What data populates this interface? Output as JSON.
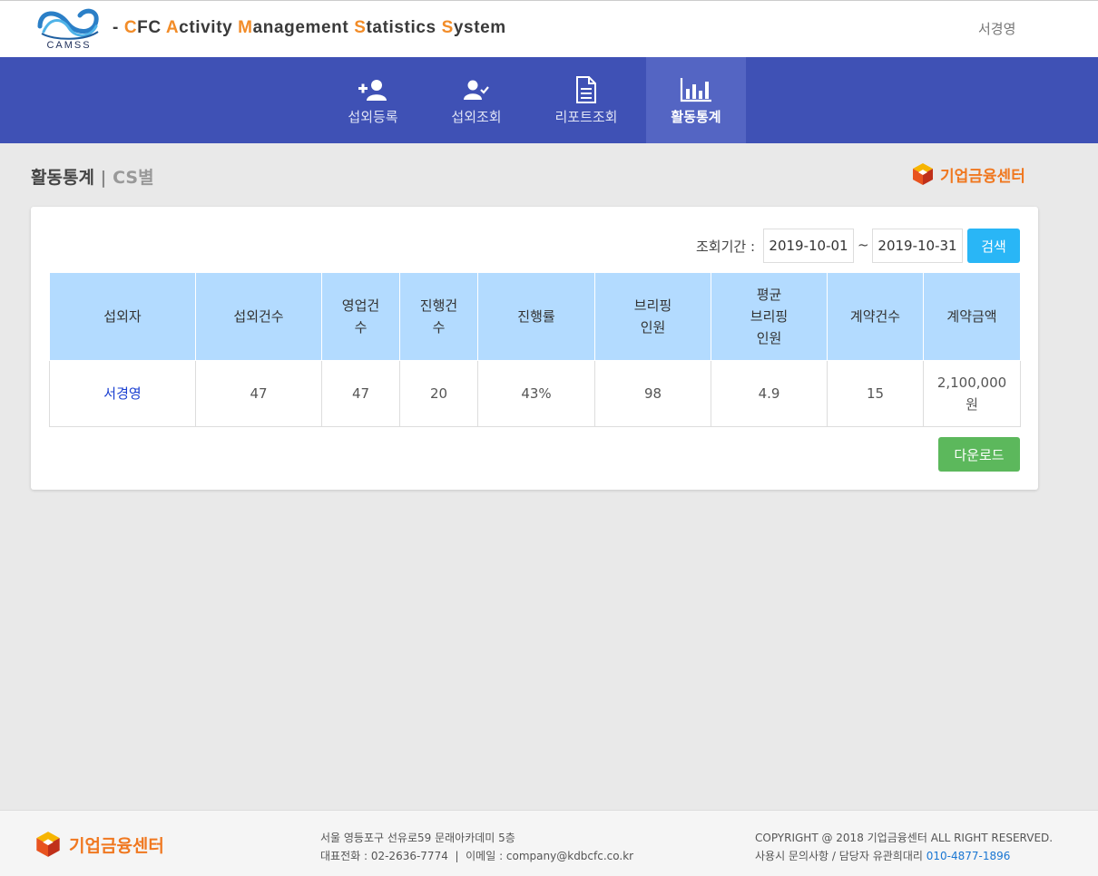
{
  "header": {
    "title_parts": [
      {
        "text": "- ",
        "hl": false
      },
      {
        "text": "C",
        "hl": true
      },
      {
        "text": "FC ",
        "hl": false
      },
      {
        "text": "A",
        "hl": true
      },
      {
        "text": "ctivity ",
        "hl": false
      },
      {
        "text": "M",
        "hl": true
      },
      {
        "text": "anagement ",
        "hl": false
      },
      {
        "text": "S",
        "hl": true
      },
      {
        "text": "tatistics ",
        "hl": false
      },
      {
        "text": "S",
        "hl": true
      },
      {
        "text": "ystem",
        "hl": false
      }
    ],
    "logo_text": "CAMSS",
    "user_name": "서경영"
  },
  "nav": {
    "items": [
      {
        "label": "섭외등록",
        "icon": "user-plus-icon"
      },
      {
        "label": "섭외조회",
        "icon": "user-check-icon"
      },
      {
        "label": "리포트조회",
        "icon": "document-icon"
      },
      {
        "label": "활동통계",
        "icon": "bar-chart-icon",
        "active": true
      }
    ]
  },
  "page": {
    "title": "활동통계",
    "separator": "|",
    "subtitle": "CS별",
    "brand": "기업금융센터"
  },
  "search": {
    "label": "조회기간 :",
    "start_date": "2019-10-01",
    "tilde": "~",
    "end_date": "2019-10-31",
    "button": "검색"
  },
  "table": {
    "headers": [
      "섭외자",
      "섭외건수",
      "영업건\n수",
      "진행건\n수",
      "진행률",
      "브리핑\n인원",
      "평균\n브리핑\n인원",
      "계약건수",
      "계약금액"
    ],
    "rows": [
      [
        "서경영",
        "47",
        "47",
        "20",
        "43%",
        "98",
        "4.9",
        "15",
        "2,100,000\n원"
      ]
    ]
  },
  "download_button": "다운로드",
  "footer": {
    "brand": "기업금융센터",
    "address": "서울 영등포구 선유로59 문래아카데미 5층",
    "contact": "대표전화 : 02-2636-7774  |  이메일 : company@kdbcfc.co.kr",
    "copyright": "COPYRIGHT @ 2018 기업금융센터 ALL RIGHT RESERVED.",
    "inquiry_prefix": "사용시 문의사항 / 담당자 유관희대리 ",
    "inquiry_phone": "010-4877-1896"
  },
  "colors": {
    "nav_bg": "#3f51b5",
    "nav_active": "#5465c3",
    "header_row": "#b3dbff",
    "search_btn": "#29b6f6",
    "download_btn": "#5cb85c",
    "brand_orange": "#f07820"
  }
}
